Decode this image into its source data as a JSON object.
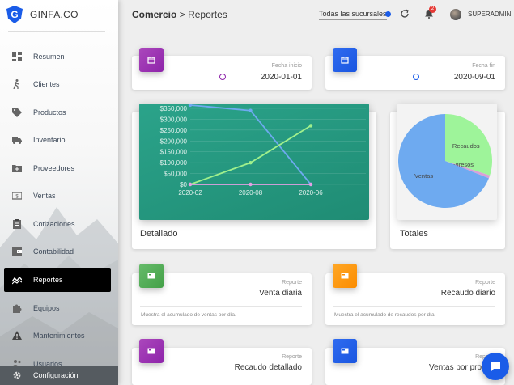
{
  "brand": {
    "name": "GINFA.CO",
    "logo_letter": "G"
  },
  "sidebar": {
    "items": [
      {
        "label": "Resumen",
        "icon": "dashboard-icon"
      },
      {
        "label": "Clientes",
        "icon": "person-walking-icon"
      },
      {
        "label": "Productos",
        "icon": "tag-icon"
      },
      {
        "label": "Inventario",
        "icon": "truck-icon"
      },
      {
        "label": "Proveedores",
        "icon": "folder-plus-icon"
      },
      {
        "label": "Ventas",
        "icon": "money-icon"
      },
      {
        "label": "Cotizaciones",
        "icon": "clipboard-icon"
      },
      {
        "label": "Contabilidad",
        "icon": "wallet-icon"
      },
      {
        "label": "Reportes",
        "icon": "trend-icon",
        "active": true
      },
      {
        "label": "Equipos",
        "icon": "puzzle-icon"
      },
      {
        "label": "Mantenimientos",
        "icon": "warning-icon"
      },
      {
        "label": "Usuarios",
        "icon": "users-icon"
      }
    ],
    "footer": {
      "label": "Configuración",
      "icon": "gear-icon"
    }
  },
  "header": {
    "breadcrumb_root": "Comercio",
    "breadcrumb_sep": ">",
    "breadcrumb_page": "Reportes",
    "branch_selector": "Todas las sucursales",
    "notification_count": "2",
    "user_name": "SUPERADMIN"
  },
  "filters": {
    "start": {
      "label": "Fecha inicio",
      "value": "2020-01-01"
    },
    "end": {
      "label": "Fecha fin",
      "value": "2020-09-01"
    }
  },
  "detail_chart": {
    "title": "Detallado"
  },
  "totals_chart": {
    "title": "Totales"
  },
  "reports": [
    {
      "label": "Reporte",
      "title": "Venta diaria",
      "description": "Muestra el acumulado de ventas por día."
    },
    {
      "label": "Reporte",
      "title": "Recaudo diario",
      "description": "Muestra el acumulado de recaudos por día."
    },
    {
      "label": "Reporte",
      "title": "Recaudo detallado"
    },
    {
      "label": "Reporte",
      "title": "Ventas por prod"
    }
  ],
  "colors": {
    "accent_blue": "#1a5ce8",
    "purple": "#8e24aa",
    "green": "#43a047",
    "orange": "#fb8c00",
    "chart_bg": "#239a80",
    "pie_ventas": "#6eaaf0",
    "pie_recaudos": "#9ef49a",
    "pie_egresos": "#d8a0d8"
  },
  "chart_data": [
    {
      "type": "line",
      "x": [
        "2020-02",
        "2020-08",
        "2020-06"
      ],
      "ylim": [
        0,
        350000
      ],
      "ytick_labels": [
        "$0",
        "$50,000",
        "$100,000",
        "$150,000",
        "$200,000",
        "$250,000",
        "$300,000",
        "$350,000"
      ],
      "series": [
        {
          "color": "#6eaaf0",
          "values": [
            365000,
            340000,
            0
          ]
        },
        {
          "color": "#a0f08c",
          "values": [
            0,
            100000,
            270000
          ]
        },
        {
          "color": "#e4a0e4",
          "values": [
            0,
            0,
            0
          ]
        }
      ]
    },
    {
      "type": "pie",
      "labels": [
        "Ventas",
        "Recaudos",
        "Egresos"
      ],
      "values": [
        69,
        30,
        1
      ],
      "colors": [
        "#6eaaf0",
        "#9ef49a",
        "#d8a0d8"
      ]
    }
  ]
}
